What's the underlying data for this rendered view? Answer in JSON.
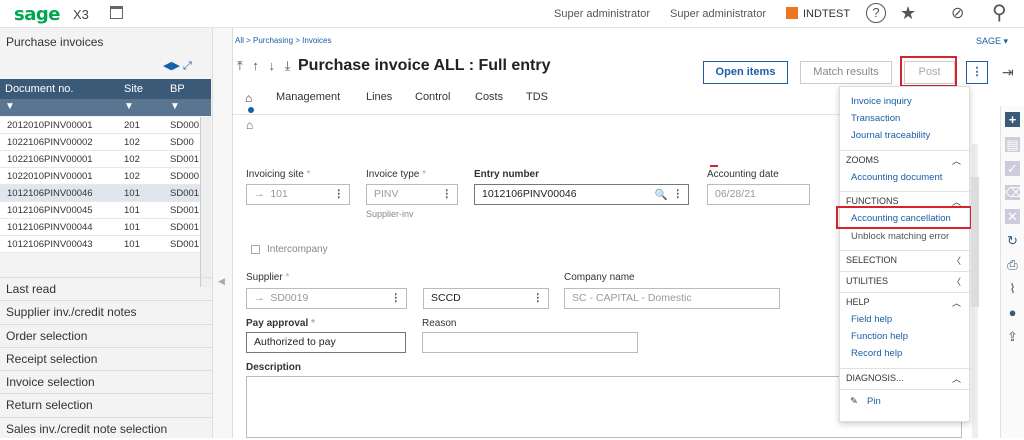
{
  "topbar": {
    "logo": "sage",
    "product": "X3",
    "user1": "Super administrator",
    "user2": "Super administrator",
    "folder": "INDTEST",
    "help_icon": "?",
    "star_icon": "★",
    "compass_icon": "⊘",
    "search_icon": "⚲"
  },
  "left": {
    "title": "Purchase invoices",
    "nav": "◀▶ ⤢",
    "columns": [
      "Document no.",
      "Site",
      "BP"
    ],
    "rows": [
      [
        "2012010PINV00001",
        "201",
        "SD000"
      ],
      [
        "1022106PINV00002",
        "102",
        "SD00"
      ],
      [
        "1022106PINV00001",
        "102",
        "SD001"
      ],
      [
        "1022010PINV00001",
        "102",
        "SD000"
      ],
      [
        "1012106PINV00046",
        "101",
        "SD001"
      ],
      [
        "1012106PINV00045",
        "101",
        "SD001"
      ],
      [
        "1012106PINV00044",
        "101",
        "SD001"
      ],
      [
        "1012106PINV00043",
        "101",
        "SD001"
      ]
    ],
    "links": [
      "Last read",
      "Supplier inv./credit notes",
      "Order selection",
      "Receipt selection",
      "Invoice selection",
      "Return selection",
      "Sales inv./credit note selection"
    ]
  },
  "main": {
    "breadcrumb": "All  >  Purchasing  >  Invoices",
    "sage_dd": "SAGE  ▾",
    "nav_arrows": "⤒ ↑ ↓ ⤓",
    "title": "Purchase invoice ALL : Full entry",
    "buttons": {
      "open_items": "Open items",
      "match_results": "Match results",
      "post": "Post",
      "more": "⋮",
      "exit": "⇥"
    },
    "tabs": [
      "Management",
      "Lines",
      "Control",
      "Costs",
      "TDS"
    ],
    "home_icon": "⌂"
  },
  "form": {
    "invoicing_site_label": "Invoicing site",
    "invoicing_site": "101",
    "invoice_type_label": "Invoice type",
    "invoice_type": "PINV",
    "invoice_type_desc": "Supplier-inv",
    "entry_number_label": "Entry number",
    "entry_number": "1012106PINV00046",
    "accounting_date_label": "Accounting date",
    "accounting_date": "06/28/21",
    "intercompany_label": "Intercompany",
    "supplier_label": "Supplier",
    "supplier": "SD0019",
    "supplier_short": "SCCD",
    "company_name_label": "Company name",
    "company_name": "SC - CAPITAL - Domestic",
    "pay_approval_label": "Pay approval",
    "pay_approval": "Authorized to pay",
    "reason_label": "Reason",
    "description_label": "Description"
  },
  "menu": {
    "items_top": [
      "Invoice inquiry",
      "Transaction",
      "Journal traceability"
    ],
    "zooms": "ZOOMS",
    "zooms_items": [
      "Accounting document"
    ],
    "functions": "FUNCTIONS",
    "functions_items": [
      "Accounting cancellation",
      "Unblock matching error"
    ],
    "selection": "SELECTION",
    "utilities": "UTILITIES",
    "help": "HELP",
    "help_items": [
      "Field help",
      "Function help",
      "Record help"
    ],
    "diagnosis": "DIAGNOSIS...",
    "pin": "Pin"
  },
  "colors": {
    "brand": "#00a651",
    "header": "#3a5a78",
    "link": "#1a5ea8",
    "highlight": "#d0262c",
    "folder": "#ee7623"
  }
}
